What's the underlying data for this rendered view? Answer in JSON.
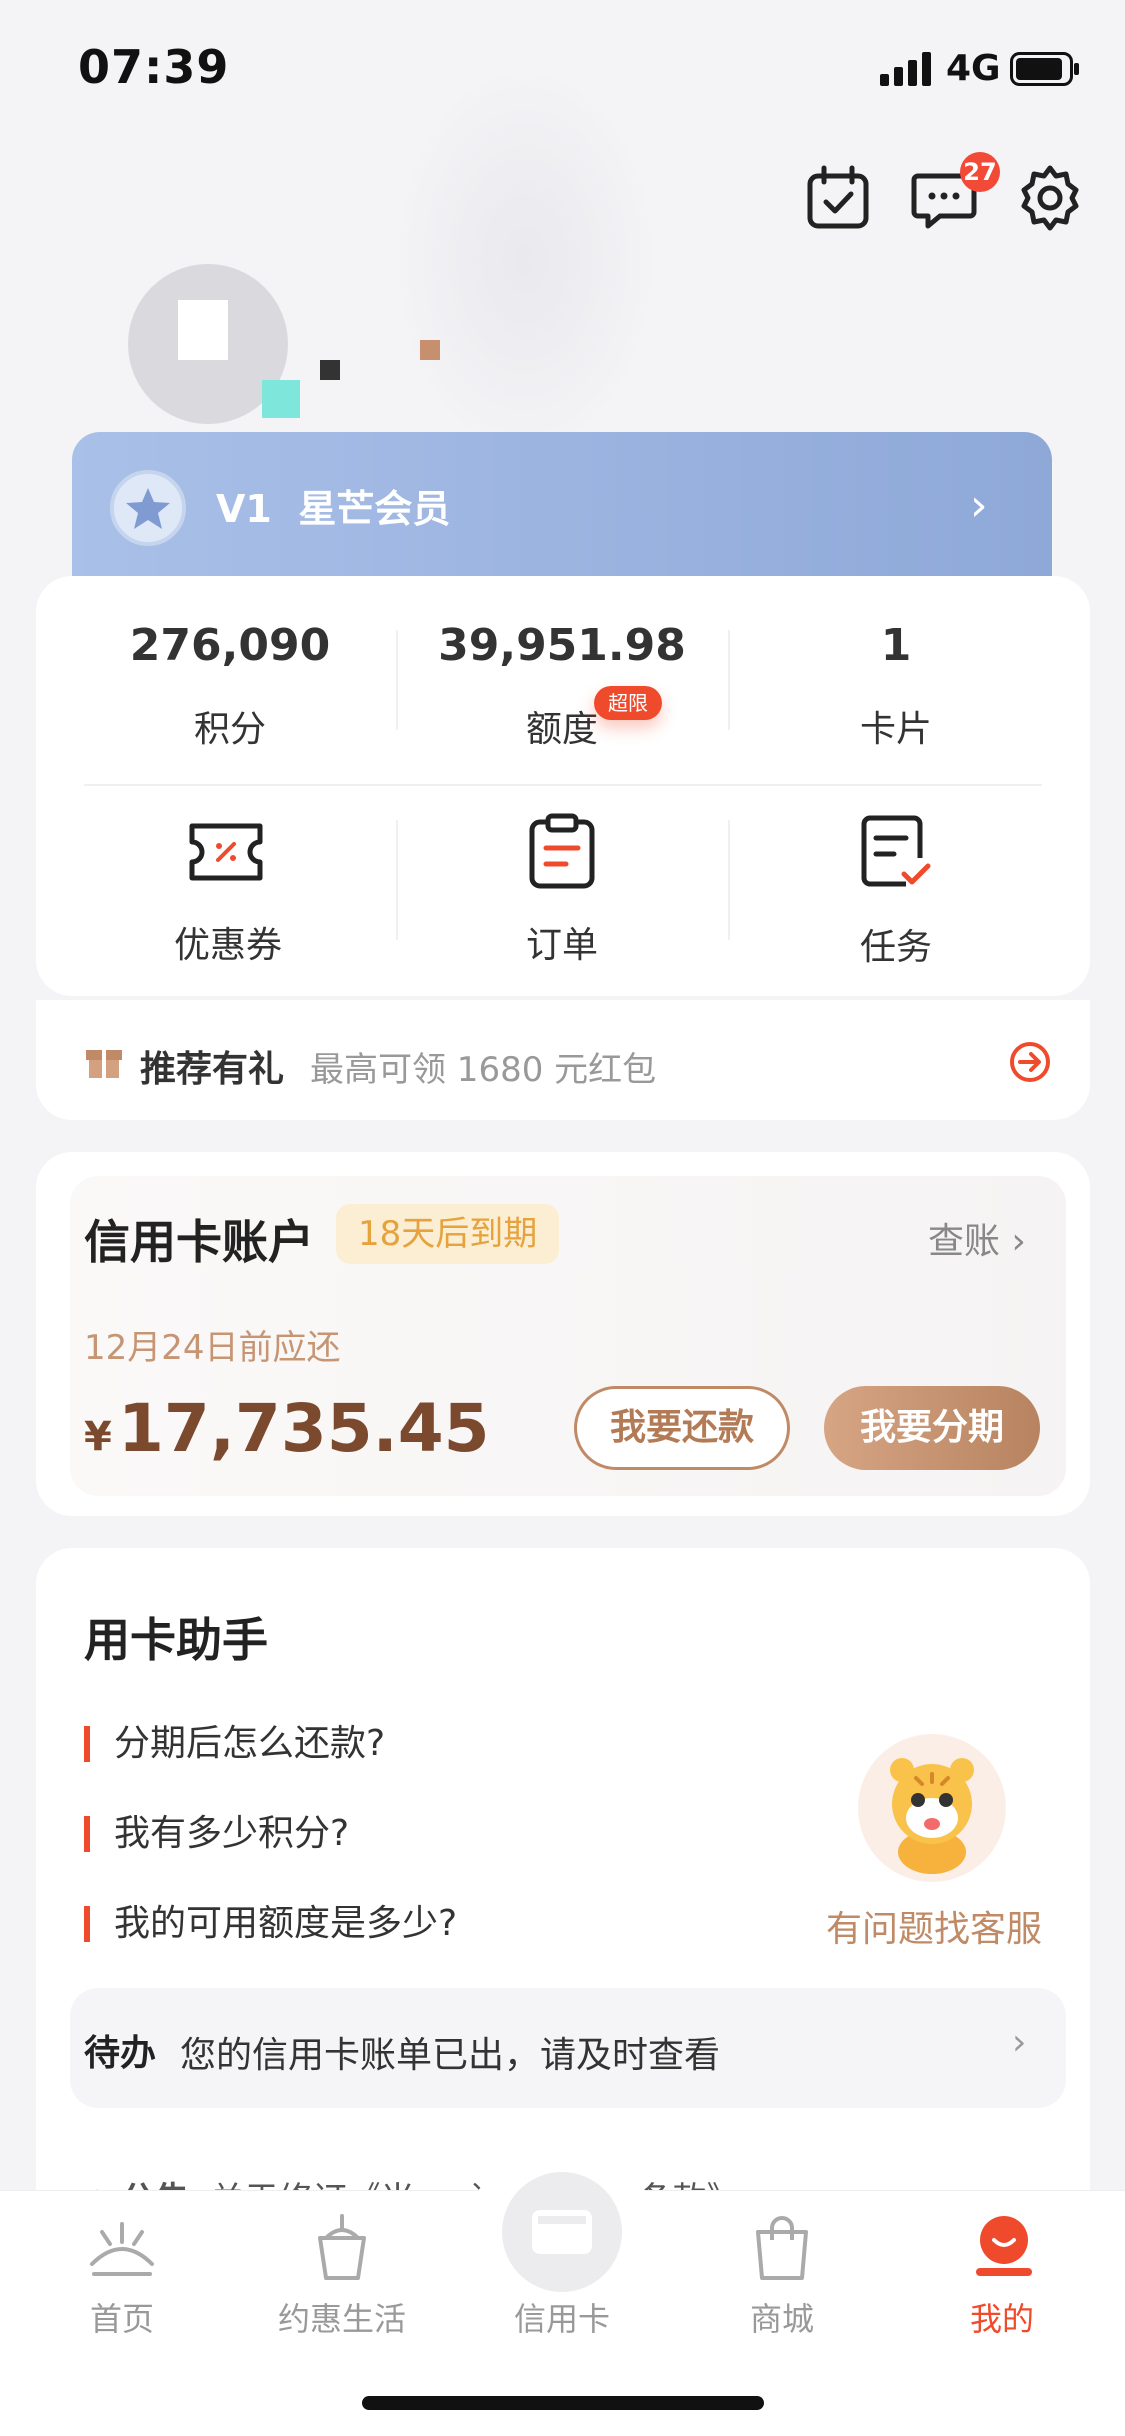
{
  "status_bar": {
    "time": "07:39",
    "network": "4G"
  },
  "header": {
    "message_badge": "27"
  },
  "membership": {
    "level": "V1",
    "name": "星芒会员"
  },
  "stats": [
    {
      "value": "276,090",
      "label": "积分"
    },
    {
      "value": "39,951.98",
      "label": "额度",
      "badge": "超限"
    },
    {
      "value": "1",
      "label": "卡片"
    }
  ],
  "quick_actions": [
    {
      "label": "优惠券",
      "icon": "coupon-icon"
    },
    {
      "label": "订单",
      "icon": "order-icon"
    },
    {
      "label": "任务",
      "icon": "task-icon"
    }
  ],
  "recommend": {
    "title": "推荐有礼",
    "subtitle": "最高可领 1680 元红包"
  },
  "credit_account": {
    "title": "信用卡账户",
    "due_tag": "18天后到期",
    "bill_link": "查账",
    "due_text": "12月24日前应还",
    "currency": "¥",
    "amount": "17,735.45",
    "repay_button": "我要还款",
    "installment_button": "我要分期"
  },
  "assistant": {
    "title": "用卡助手",
    "questions": [
      "分期后怎么还款?",
      "我有多少积分?",
      "我的可用额度是多少?"
    ],
    "service_link": "有问题找客服"
  },
  "todo": {
    "label": "待办",
    "text": "您的信用卡账单已出，请及时查看"
  },
  "notice": {
    "label": "公告",
    "text": "关于修订《当 ... 计划细则及条款》"
  },
  "tabbar": [
    {
      "label": "首页",
      "active": false
    },
    {
      "label": "约惠生活",
      "active": false
    },
    {
      "label": "信用卡",
      "active": false
    },
    {
      "label": "商城",
      "active": false
    },
    {
      "label": "我的",
      "active": true
    }
  ],
  "colors": {
    "accent": "#f04a2c",
    "gold": "#c08a66",
    "vip_blue": "#9ab3e0"
  }
}
